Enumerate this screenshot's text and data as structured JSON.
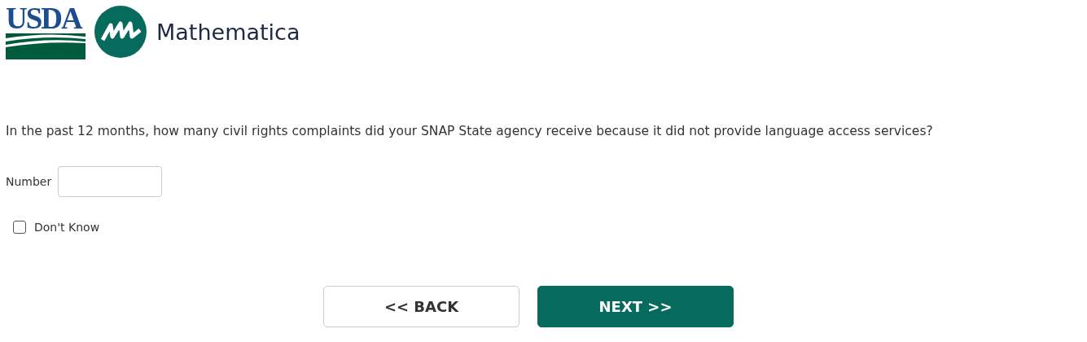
{
  "logos": {
    "agency": "USDA",
    "partner": "Mathematica"
  },
  "question": "In the past 12 months, how many civil rights complaints did your SNAP State agency receive because it did not provide language access services?",
  "number_field": {
    "label": "Number"
  },
  "dont_know": {
    "label": "Don't Know",
    "checked": false
  },
  "buttons": [
    {
      "kind": "back",
      "label": "<< BACK"
    },
    {
      "kind": "next",
      "label": "NEXT >>"
    }
  ]
}
